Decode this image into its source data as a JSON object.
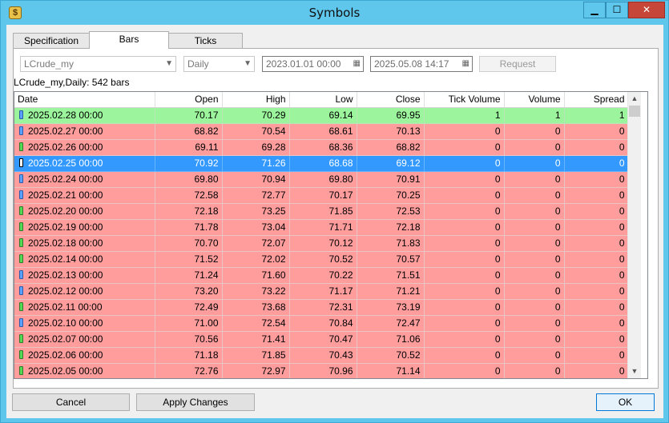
{
  "window": {
    "title": "Symbols",
    "controls": {
      "minimize": "▁",
      "maximize": "☐",
      "close": "✕"
    }
  },
  "tabs": [
    {
      "label": "Specification"
    },
    {
      "label": "Bars",
      "active": true
    },
    {
      "label": "Ticks"
    }
  ],
  "filters": {
    "symbol": "LCrude_my",
    "timeframe": "Daily",
    "from": "2023.01.01 00:00",
    "to": "2025.05.08 14:17",
    "request_label": "Request"
  },
  "summary": "LCrude_my,Daily: 542 bars",
  "table": {
    "columns": [
      "Date",
      "Open",
      "High",
      "Low",
      "Close",
      "Tick Volume",
      "Volume",
      "Spread"
    ],
    "rows": [
      {
        "date": "2025.02.28 00:00",
        "open": "70.17",
        "high": "70.29",
        "low": "69.14",
        "close": "69.95",
        "tick_volume": "1",
        "volume": "1",
        "spread": "1",
        "state": "green",
        "candle": "blue"
      },
      {
        "date": "2025.02.27 00:00",
        "open": "68.82",
        "high": "70.54",
        "low": "68.61",
        "close": "70.13",
        "tick_volume": "0",
        "volume": "0",
        "spread": "0",
        "state": "red",
        "candle": "blue"
      },
      {
        "date": "2025.02.26 00:00",
        "open": "69.11",
        "high": "69.28",
        "low": "68.36",
        "close": "68.82",
        "tick_volume": "0",
        "volume": "0",
        "spread": "0",
        "state": "red",
        "candle": "green"
      },
      {
        "date": "2025.02.25 00:00",
        "open": "70.92",
        "high": "71.26",
        "low": "68.68",
        "close": "69.12",
        "tick_volume": "0",
        "volume": "0",
        "spread": "0",
        "state": "sel",
        "candle": "white"
      },
      {
        "date": "2025.02.24 00:00",
        "open": "69.80",
        "high": "70.94",
        "low": "69.80",
        "close": "70.91",
        "tick_volume": "0",
        "volume": "0",
        "spread": "0",
        "state": "red",
        "candle": "blue"
      },
      {
        "date": "2025.02.21 00:00",
        "open": "72.58",
        "high": "72.77",
        "low": "70.17",
        "close": "70.25",
        "tick_volume": "0",
        "volume": "0",
        "spread": "0",
        "state": "red",
        "candle": "blue"
      },
      {
        "date": "2025.02.20 00:00",
        "open": "72.18",
        "high": "73.25",
        "low": "71.85",
        "close": "72.53",
        "tick_volume": "0",
        "volume": "0",
        "spread": "0",
        "state": "red",
        "candle": "green"
      },
      {
        "date": "2025.02.19 00:00",
        "open": "71.78",
        "high": "73.04",
        "low": "71.71",
        "close": "72.18",
        "tick_volume": "0",
        "volume": "0",
        "spread": "0",
        "state": "red",
        "candle": "green"
      },
      {
        "date": "2025.02.18 00:00",
        "open": "70.70",
        "high": "72.07",
        "low": "70.12",
        "close": "71.83",
        "tick_volume": "0",
        "volume": "0",
        "spread": "0",
        "state": "red",
        "candle": "green"
      },
      {
        "date": "2025.02.14 00:00",
        "open": "71.52",
        "high": "72.02",
        "low": "70.52",
        "close": "70.57",
        "tick_volume": "0",
        "volume": "0",
        "spread": "0",
        "state": "red",
        "candle": "green"
      },
      {
        "date": "2025.02.13 00:00",
        "open": "71.24",
        "high": "71.60",
        "low": "70.22",
        "close": "71.51",
        "tick_volume": "0",
        "volume": "0",
        "spread": "0",
        "state": "red",
        "candle": "blue"
      },
      {
        "date": "2025.02.12 00:00",
        "open": "73.20",
        "high": "73.22",
        "low": "71.17",
        "close": "71.21",
        "tick_volume": "0",
        "volume": "0",
        "spread": "0",
        "state": "red",
        "candle": "blue"
      },
      {
        "date": "2025.02.11 00:00",
        "open": "72.49",
        "high": "73.68",
        "low": "72.31",
        "close": "73.19",
        "tick_volume": "0",
        "volume": "0",
        "spread": "0",
        "state": "red",
        "candle": "green"
      },
      {
        "date": "2025.02.10 00:00",
        "open": "71.00",
        "high": "72.54",
        "low": "70.84",
        "close": "72.47",
        "tick_volume": "0",
        "volume": "0",
        "spread": "0",
        "state": "red",
        "candle": "blue"
      },
      {
        "date": "2025.02.07 00:00",
        "open": "70.56",
        "high": "71.41",
        "low": "70.47",
        "close": "71.06",
        "tick_volume": "0",
        "volume": "0",
        "spread": "0",
        "state": "red",
        "candle": "green"
      },
      {
        "date": "2025.02.06 00:00",
        "open": "71.18",
        "high": "71.85",
        "low": "70.43",
        "close": "70.52",
        "tick_volume": "0",
        "volume": "0",
        "spread": "0",
        "state": "red",
        "candle": "green"
      },
      {
        "date": "2025.02.05 00:00",
        "open": "72.76",
        "high": "72.97",
        "low": "70.96",
        "close": "71.14",
        "tick_volume": "0",
        "volume": "0",
        "spread": "0",
        "state": "red",
        "candle": "green"
      }
    ]
  },
  "buttons": {
    "cancel": "Cancel",
    "apply": "Apply Changes",
    "ok": "OK"
  },
  "colors": {
    "row_red": "#ff9c9c",
    "row_green": "#9cf59c",
    "row_selected": "#3399ff",
    "title_bar": "#5fc6ec",
    "close_button": "#c7463a"
  },
  "icons": {
    "app": "dollar-coin-icon",
    "calendar": "calendar-icon",
    "dropdown": "chevron-down-icon",
    "scroll_up": "arrow-up-icon",
    "scroll_down": "arrow-down-icon"
  }
}
